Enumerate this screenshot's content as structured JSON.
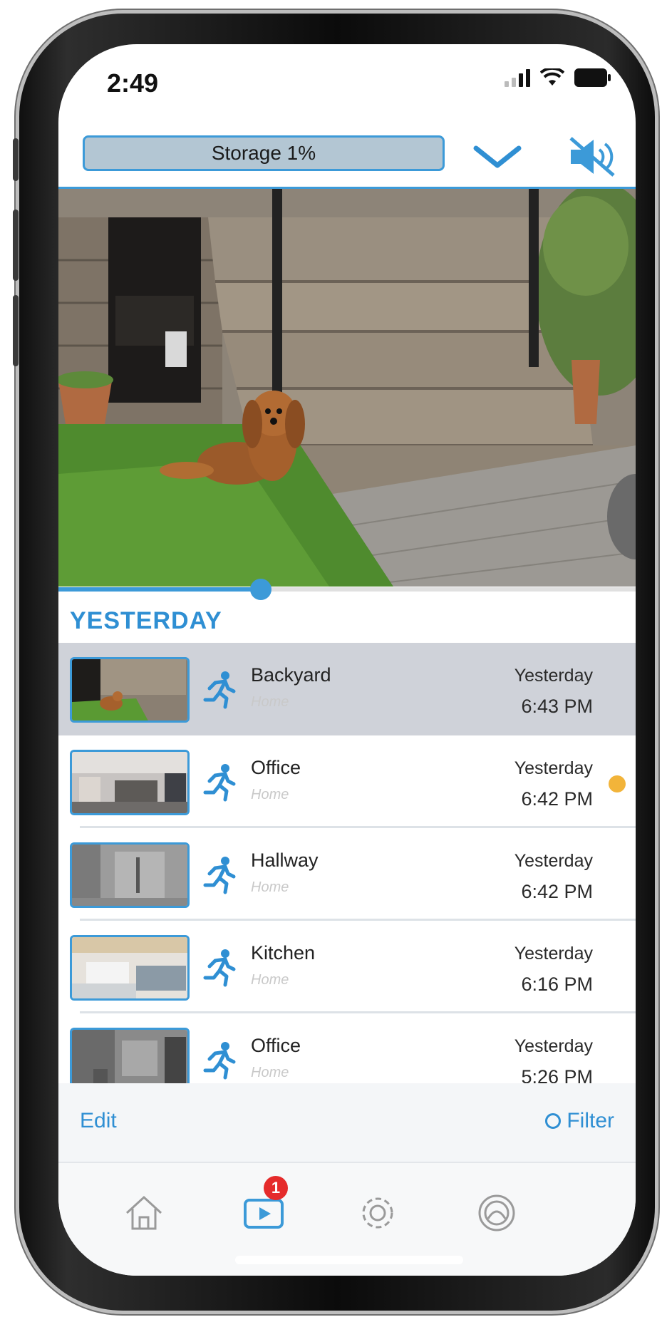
{
  "status_bar": {
    "time": "2:49"
  },
  "header": {
    "storage_label": "Storage 1%"
  },
  "playback": {
    "progress_fraction": 0.35
  },
  "section_title": "YESTERDAY",
  "events": [
    {
      "camera": "Backyard",
      "location": "Home",
      "date": "Yesterday",
      "time": "6:43 PM",
      "selected": true,
      "unread": false,
      "thumb": "garden"
    },
    {
      "camera": "Office",
      "location": "Home",
      "date": "Yesterday",
      "time": "6:42 PM",
      "selected": false,
      "unread": true,
      "thumb": "office"
    },
    {
      "camera": "Hallway",
      "location": "Home",
      "date": "Yesterday",
      "time": "6:42 PM",
      "selected": false,
      "unread": false,
      "thumb": "hallway"
    },
    {
      "camera": "Kitchen",
      "location": "Home",
      "date": "Yesterday",
      "time": "6:16 PM",
      "selected": false,
      "unread": false,
      "thumb": "kitchen"
    },
    {
      "camera": "Office",
      "location": "Home",
      "date": "Yesterday",
      "time": "5:26 PM",
      "selected": false,
      "unread": false,
      "thumb": "office-gray"
    }
  ],
  "toolbar": {
    "edit_label": "Edit",
    "filter_label": "Filter"
  },
  "tabs": [
    {
      "name": "home",
      "icon": "home-icon",
      "active": false
    },
    {
      "name": "events",
      "icon": "play-video-icon",
      "active": true,
      "badge": "1"
    },
    {
      "name": "settings",
      "icon": "gear-icon",
      "active": false
    },
    {
      "name": "account",
      "icon": "profile-icon",
      "active": false
    }
  ],
  "colors": {
    "accent": "#3c9ad8",
    "selected_row": "#cfd2d9",
    "unread_dot": "#f2b43a",
    "badge": "#e52b2b"
  }
}
